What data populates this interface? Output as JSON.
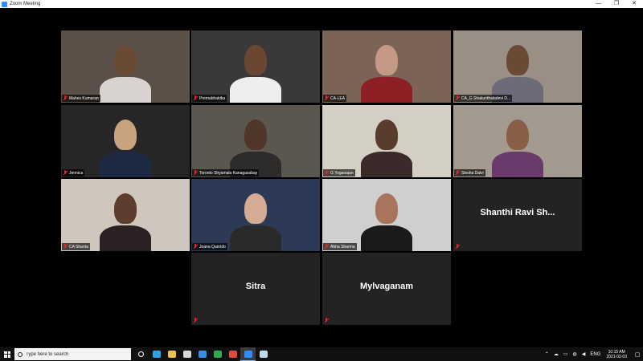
{
  "window": {
    "title": "Zoom Meeting",
    "controls": {
      "minimize": "—",
      "maximize": "❐",
      "close": "✕"
    }
  },
  "participants": [
    {
      "name": "Mahes Kumaran",
      "video": true,
      "bg": "#5a5048",
      "skin": "#6b4a35",
      "shirt": "#d8d2d0",
      "active": false
    },
    {
      "name": "Premabhaktka",
      "video": true,
      "bg": "#3a3838",
      "skin": "#6b4632",
      "shirt": "#eeeeee",
      "active": true
    },
    {
      "name": "CA-LEA",
      "video": true,
      "bg": "#7b6455",
      "skin": "#c49a86",
      "shirt": "#8e1f25",
      "active": false
    },
    {
      "name": "CA_G Shakunthaladevi D...",
      "video": true,
      "bg": "#9a8f85",
      "skin": "#6b4a35",
      "shirt": "#6e6a7a",
      "active": false
    },
    {
      "name": "Jennica",
      "video": true,
      "bg": "#262626",
      "skin": "#c9a27e",
      "shirt": "#1e2a44",
      "active": false
    },
    {
      "name": "Toronto Shyamala Kanagasabay",
      "video": true,
      "bg": "#5b574e",
      "skin": "#4f3628",
      "shirt": "#2e2b2b",
      "active": false
    },
    {
      "name": "G Yoganajan",
      "video": true,
      "bg": "#d4cfc5",
      "skin": "#5a3c2c",
      "shirt": "#3a2a2a",
      "active": false
    },
    {
      "name": "Slesha Dalvi",
      "video": true,
      "bg": "#a39a90",
      "skin": "#8a5f47",
      "shirt": "#6a3a6a",
      "active": false
    },
    {
      "name": "CA Shanta",
      "video": true,
      "bg": "#cfc7bd",
      "skin": "#5c3d2e",
      "shirt": "#2a2222",
      "active": false
    },
    {
      "name": "Joana Querido",
      "video": true,
      "bg": "#2d3a55",
      "skin": "#d6ab93",
      "shirt": "#2a2a2a",
      "active": false
    },
    {
      "name": "Abha Sharma",
      "video": true,
      "bg": "#cfcfcf",
      "skin": "#a8755c",
      "shirt": "#1a1a1a",
      "active": false
    },
    {
      "name": "Shanthi Ravi Sh...",
      "video": false,
      "active": false
    },
    {
      "name": "Sitra",
      "video": false,
      "active": false
    },
    {
      "name": "Mylvaganam",
      "video": false,
      "active": false
    }
  ],
  "taskbar": {
    "search_placeholder": "Type here to search",
    "apps": [
      {
        "icon": "task-view-icon",
        "color": "#ffffff"
      },
      {
        "icon": "edge-icon",
        "color": "#2fa4e0"
      },
      {
        "icon": "file-explorer-icon",
        "color": "#f0c24d"
      },
      {
        "icon": "store-icon",
        "color": "#d8d8d8"
      },
      {
        "icon": "mail-icon",
        "color": "#3a8ee6"
      },
      {
        "icon": "chrome-icon",
        "color": "#33a853"
      },
      {
        "icon": "chrome-icon-2",
        "color": "#e04a3a"
      },
      {
        "icon": "zoom-icon",
        "color": "#2d8cff"
      },
      {
        "icon": "notepad-icon",
        "color": "#bcd9f0"
      }
    ],
    "tray": {
      "lang": "ENG",
      "time": "10:15 AM",
      "date": "2021-02-03"
    }
  }
}
